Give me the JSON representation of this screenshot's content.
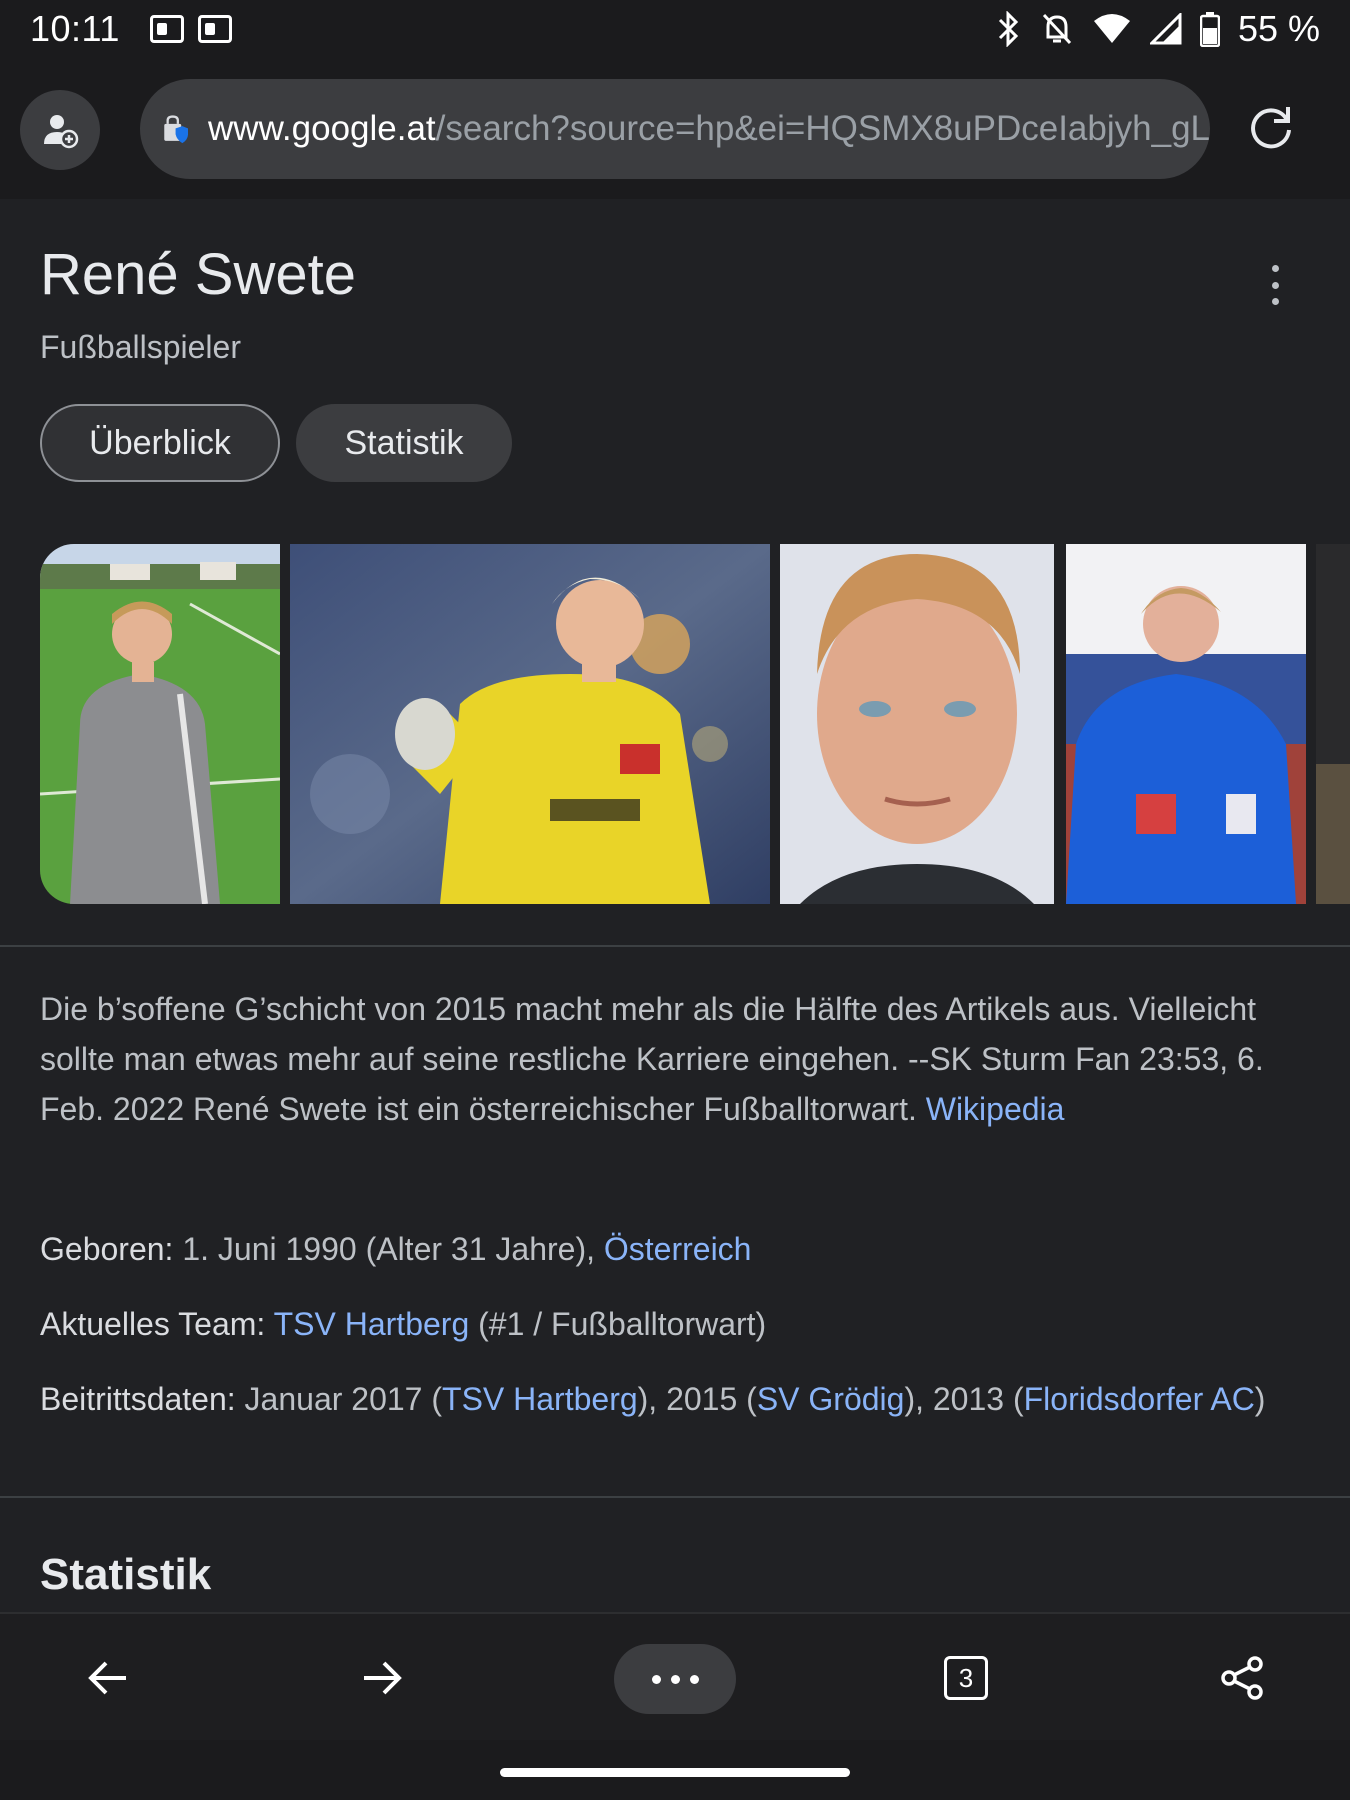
{
  "status_bar": {
    "time": "10:11",
    "battery": "55 %",
    "icons": [
      "outlook-icon",
      "outlook-icon",
      "bluetooth-icon",
      "bell-off-icon",
      "wifi-icon",
      "cell-signal-icon",
      "battery-icon"
    ]
  },
  "browser": {
    "url_domain": "www.google.at",
    "url_path": "/search?source=hp&ei=HQSMX8uPDceIabjyh_gL",
    "accent": "#8ab4f8"
  },
  "knowledge_panel": {
    "title": "René Swete",
    "subtitle": "Fußballspieler",
    "chips": [
      "Überblick",
      "Statistik"
    ],
    "description_text": "Die b’soffene G’schicht von 2015 macht mehr als die Hälfte des Artikels aus. Vielleicht sollte man etwas mehr auf seine restliche Karriere eingehen. --SK Sturm Fan 23:53, 6. Feb. 2022 René Swete ist ein österreichischer Fußballtorwart. ",
    "description_link": "Wikipedia",
    "born": {
      "label": "Geboren: ",
      "value": "1. Juni 1990 (Alter 31 Jahre), ",
      "link": "Österreich"
    },
    "team": {
      "label": "Aktuelles Team: ",
      "link": "TSV Hartberg",
      "value": " (#1 / Fußballtorwart)"
    },
    "joined": {
      "label": "Beitrittsdaten: ",
      "t1": "Januar 2017 (",
      "l1": "TSV Hartberg",
      "t2": "), 2015 (",
      "l2": "SV Grödig",
      "t3": "), 2013 (",
      "l3": "Floridsdorfer AC",
      "t4": ")"
    },
    "section_title": "Statistik"
  },
  "toolbar": {
    "tab_count": "3"
  }
}
